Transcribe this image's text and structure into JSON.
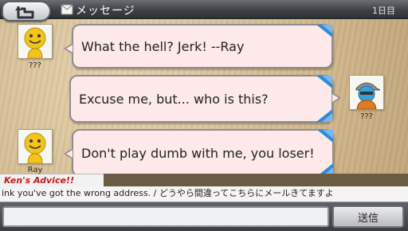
{
  "header": {
    "title": "メッセージ",
    "day": "1日目",
    "back_icon": "back-arrow-icon",
    "mail_icon": "envelope-icon"
  },
  "messages": [
    {
      "sender": "???",
      "side": "left",
      "text": "What the hell? Jerk! --Ray",
      "avatar": "yellow-smiley-avatar"
    },
    {
      "sender": "???",
      "side": "right",
      "text": "Excuse me, but... who is this?",
      "avatar": "player-cap-avatar"
    },
    {
      "sender": "Ray",
      "side": "left",
      "text": "Don't play dumb with me, you loser!",
      "avatar": "yellow-smiley-avatar"
    }
  ],
  "advice": {
    "label": "Ken's Advice!!",
    "text": "ink you've got the wrong address. / どうやら間違ってこちらにメールきてますよ"
  },
  "input": {
    "value": "",
    "placeholder": ""
  },
  "send_label": "送信",
  "colors": {
    "bubble_bg": "#fde9e9",
    "bubble_border": "#8d8d8d",
    "advice_label": "#c01a1a",
    "header_bg": "#3d4046"
  }
}
